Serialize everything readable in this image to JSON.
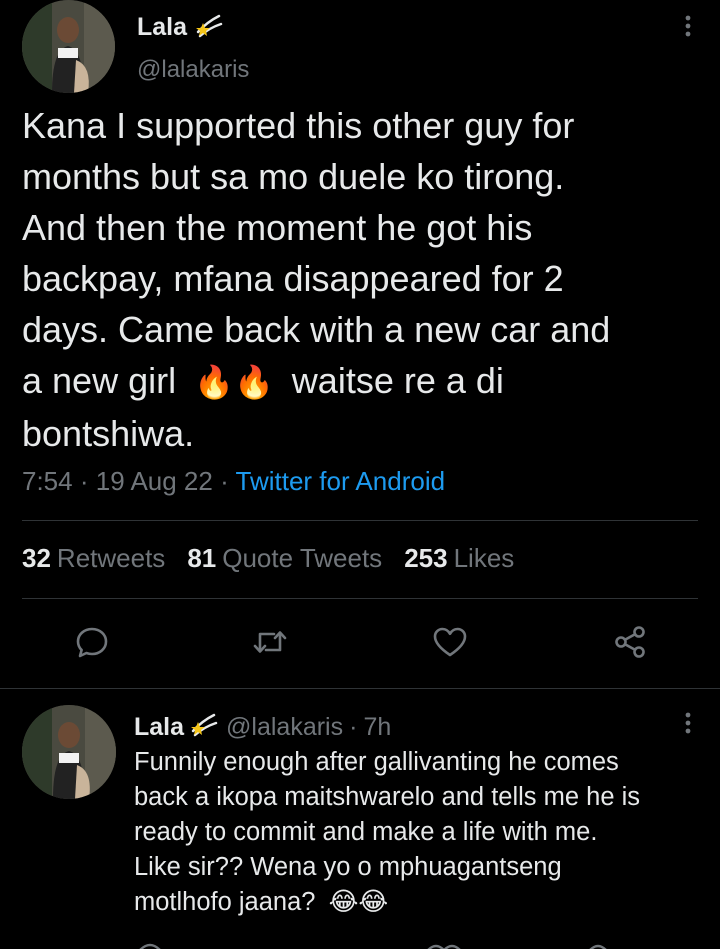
{
  "tweet": {
    "display_name": "Lala",
    "handle": "@lalakaris",
    "text_lines": [
      "Kana I supported this other guy for",
      "months but sa mo duele ko tirong.",
      "And then the moment he got his",
      "backpay, mfana disappeared for 2",
      "days. Came back with a new car and",
      "a new girl",
      "waitse re a di",
      "bontshiwa."
    ],
    "emoji": "🔥🔥",
    "time": "7:54",
    "date": "19 Aug 22",
    "source": "Twitter for Android",
    "retweets_count": "32",
    "retweets_label": "Retweets",
    "quotes_count": "81",
    "quotes_label": "Quote Tweets",
    "likes_count": "253",
    "likes_label": "Likes"
  },
  "reply": {
    "display_name": "Lala",
    "handle": "@lalakaris",
    "age": "7h",
    "text_lines": [
      "Funnily enough after gallivanting he comes",
      "back a ikopa maitshwarelo and tells me he is",
      "ready to commit and make a life with me.",
      "Like sir?? Wena yo o mphuagantseng",
      "motlhofo jaana?"
    ],
    "emoji": "😂😂"
  },
  "icons": {
    "badge": "shooting-star-emoji-icon",
    "more": "more-vertical-icon",
    "reply": "reply-bubble-icon",
    "retweet": "retweet-icon",
    "like": "heart-icon",
    "share": "share-icon"
  },
  "colors": {
    "background": "#000000",
    "text": "#e7e9ea",
    "secondary": "#71767b",
    "accent": "#1d9bf0",
    "divider": "#2f3336"
  }
}
